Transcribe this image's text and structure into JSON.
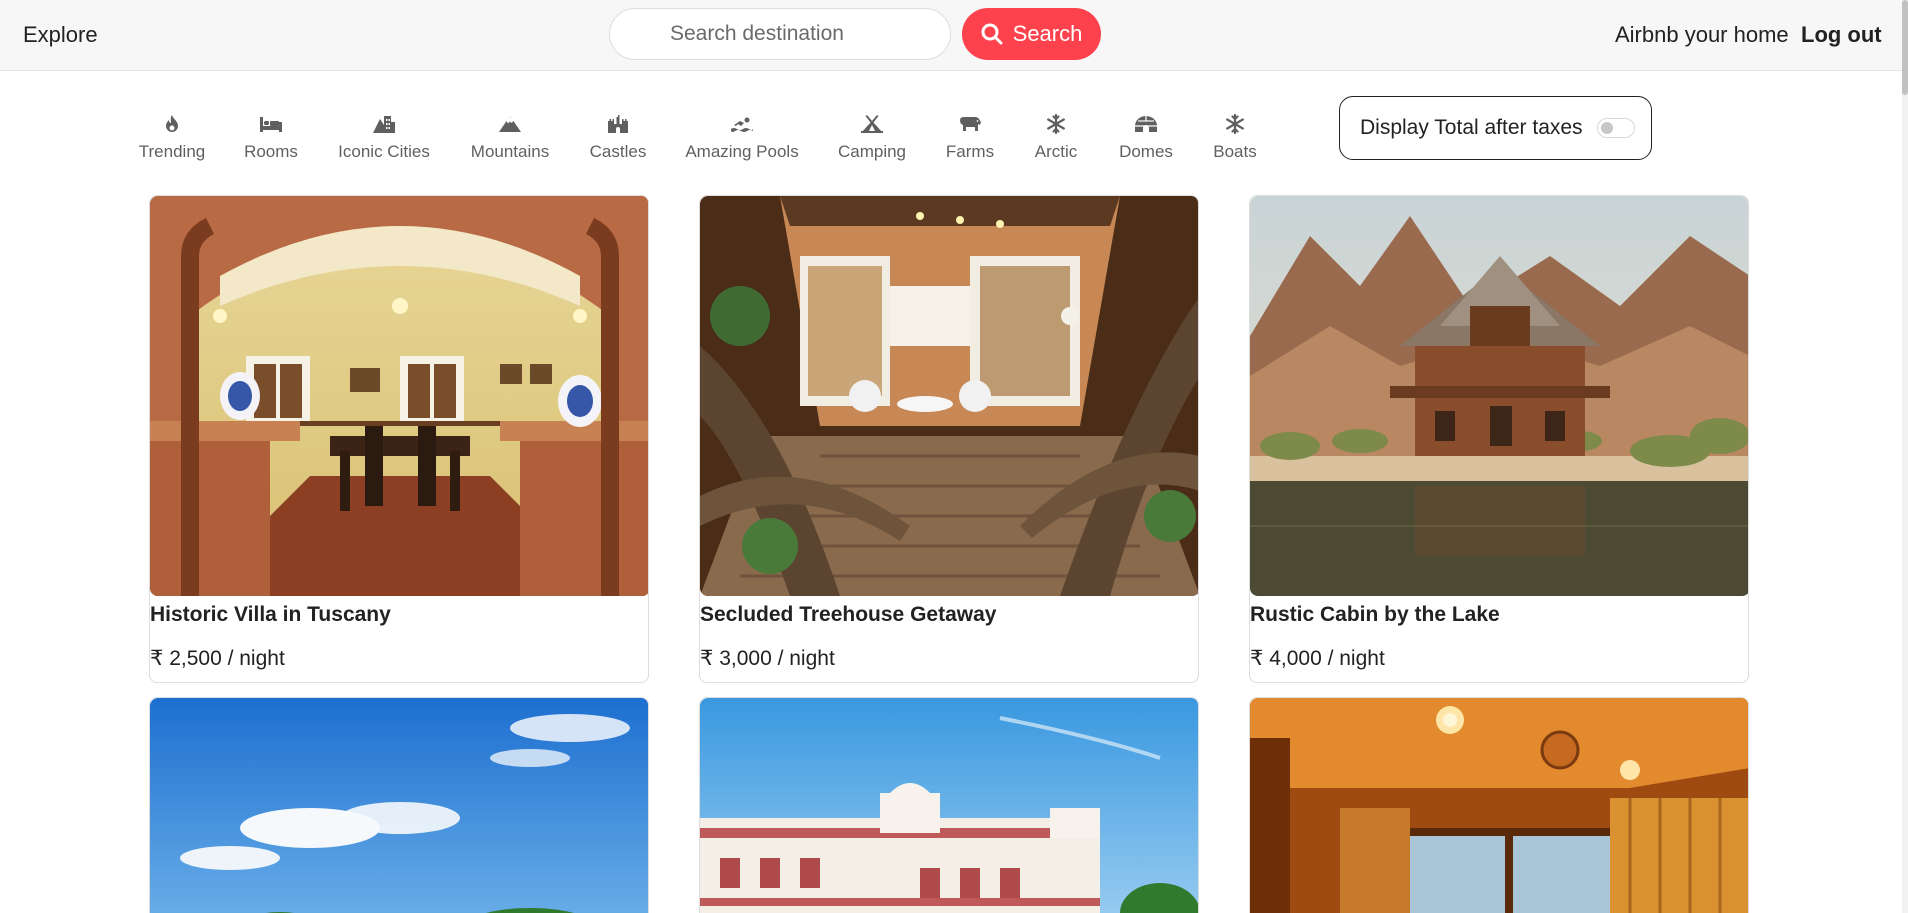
{
  "navbar": {
    "explore_label": "Explore",
    "search_placeholder": "Search destination",
    "search_button_label": "Search",
    "host_label": "Airbnb your home",
    "logout_label": "Log out",
    "accent_color": "#fe424d"
  },
  "filters": {
    "items": [
      {
        "label": "Trending",
        "icon": "fire-icon"
      },
      {
        "label": "Rooms",
        "icon": "bed-icon"
      },
      {
        "label": "Iconic Cities",
        "icon": "mountain-city-icon"
      },
      {
        "label": "Mountains",
        "icon": "mountain-icon"
      },
      {
        "label": "Castles",
        "icon": "fort-icon"
      },
      {
        "label": "Amazing Pools",
        "icon": "person-swimming-icon"
      },
      {
        "label": "Camping",
        "icon": "campground-icon"
      },
      {
        "label": "Farms",
        "icon": "cow-icon"
      },
      {
        "label": "Arctic",
        "icon": "snowflake-icon"
      },
      {
        "label": "Domes",
        "icon": "igloo-icon"
      },
      {
        "label": "Boats",
        "icon": "snowflake-icon"
      }
    ],
    "tax_toggle_label": "Display Total after taxes",
    "tax_toggle_on": false
  },
  "listings": [
    {
      "title": "Historic Villa in Tuscany",
      "price": "₹ 2,500 / night"
    },
    {
      "title": "Secluded Treehouse Getaway",
      "price": "₹ 3,000 / night"
    },
    {
      "title": "Rustic Cabin by the Lake",
      "price": "₹ 4,000 / night"
    },
    {
      "title": "",
      "price": ""
    },
    {
      "title": "",
      "price": ""
    },
    {
      "title": "",
      "price": ""
    }
  ]
}
